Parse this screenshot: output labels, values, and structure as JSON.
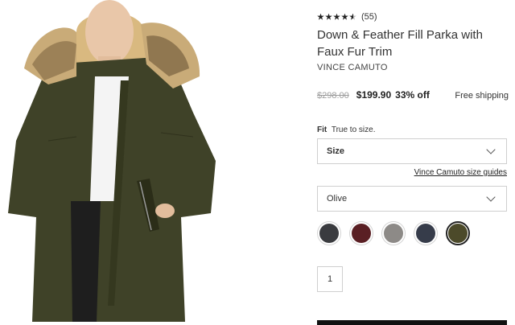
{
  "product": {
    "rating_count": "(55)",
    "rating_value": 4.5,
    "title": "Down & Feather Fill Parka with Faux Fur Trim",
    "brand": "VINCE CAMUTO",
    "original_price": "$298.00",
    "sale_price": "$199.90",
    "discount": "33% off",
    "shipping": "Free shipping",
    "image_icon": "parka-photo"
  },
  "fit": {
    "label": "Fit",
    "note": "True to size."
  },
  "size_select": {
    "label": "Size",
    "icon": "chevron-down-icon"
  },
  "size_guide_link": "Vince Camuto size guides",
  "color_select": {
    "value": "Olive",
    "icon": "chevron-down-icon"
  },
  "swatches": [
    {
      "color": "#3a3b3f",
      "selected": false
    },
    {
      "color": "#5a1f24",
      "selected": false
    },
    {
      "color": "#8d8a87",
      "selected": false
    },
    {
      "color": "#363c4a",
      "selected": false
    },
    {
      "color": "#4c4a2a",
      "selected": true
    }
  ],
  "quantity": "1",
  "colors": {
    "coat": "#3f4228",
    "fur": "#c9ab78",
    "text": "#2a2a2a",
    "muted": "#9b9b9b"
  }
}
